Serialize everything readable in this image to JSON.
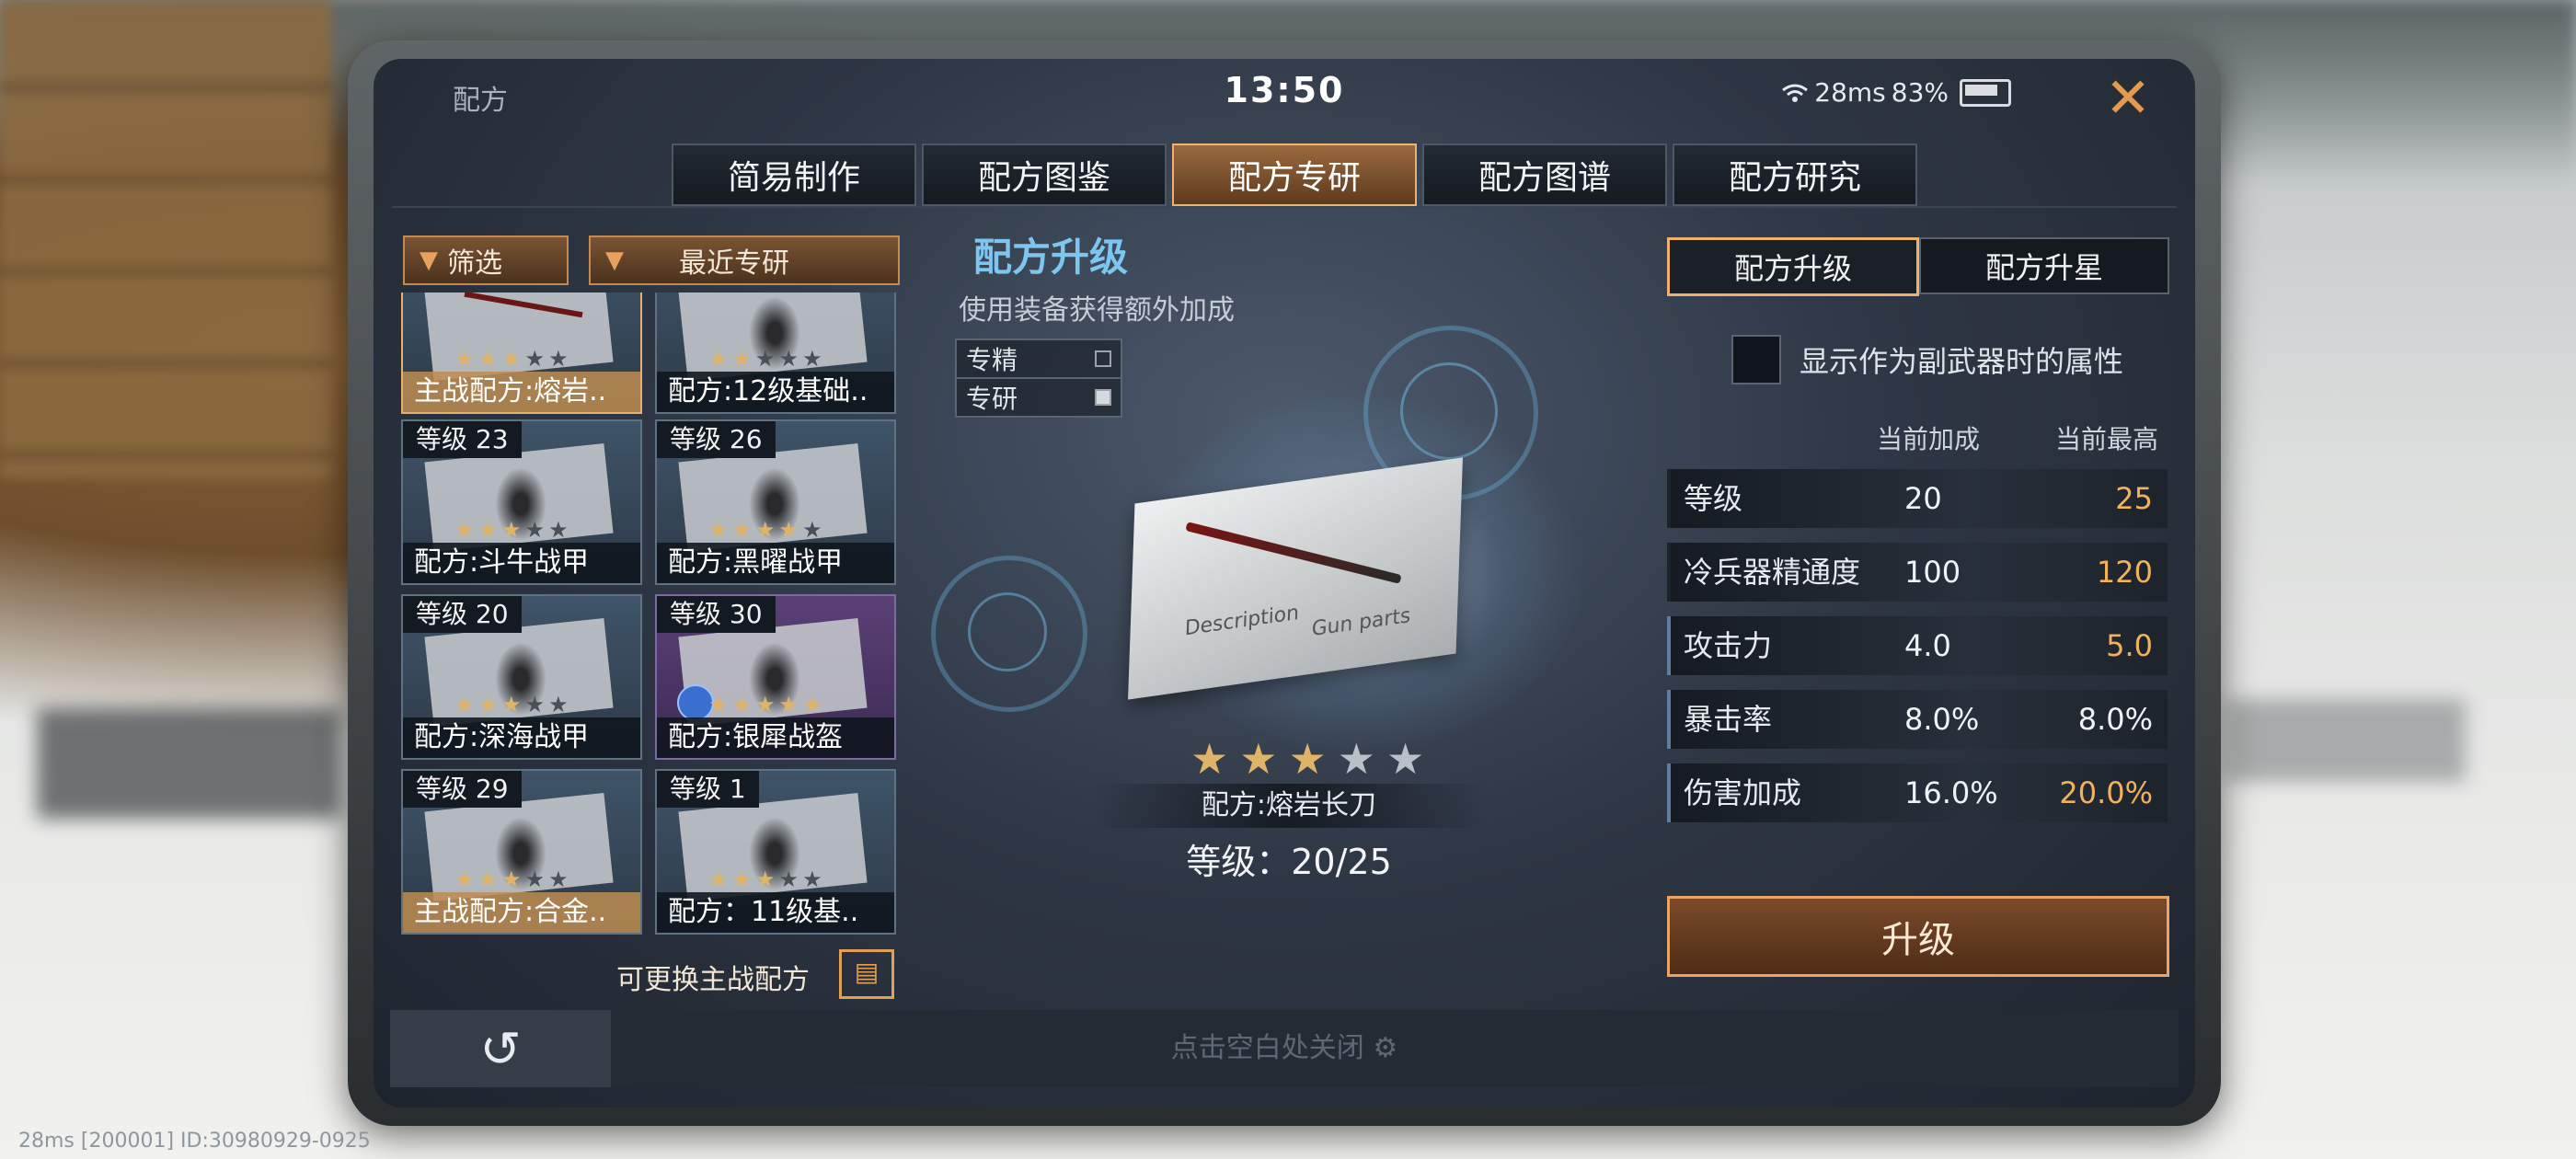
{
  "window": {
    "title": "配方",
    "time": "13:50",
    "ping": "28ms",
    "battery": "83%"
  },
  "tabs": [
    "简易制作",
    "配方图鉴",
    "配方专研",
    "配方图谱",
    "配方研究"
  ],
  "active_tab": 2,
  "filters": {
    "filter_label": "筛选",
    "recent_label": "最近专研"
  },
  "cards": [
    {
      "level": "",
      "name": "主战配方:熔岩..",
      "stars": 3,
      "selected": true
    },
    {
      "level": "",
      "name": "配方:12级基础..",
      "stars": 2,
      "selected": false
    },
    {
      "level": "等级 23",
      "name": "配方:斗牛战甲",
      "stars": 3,
      "selected": false
    },
    {
      "level": "等级 26",
      "name": "配方:黑曜战甲",
      "stars": 4,
      "selected": false
    },
    {
      "level": "等级 20",
      "name": "配方:深海战甲",
      "stars": 3,
      "selected": false
    },
    {
      "level": "等级 30",
      "name": "配方:银犀战盔",
      "stars": 5,
      "selected": false
    },
    {
      "level": "等级 29",
      "name": "主战配方:合金..",
      "stars": 3,
      "selected": false
    },
    {
      "level": "等级 1",
      "name": "配方：11级基..",
      "stars": 3,
      "selected": false
    }
  ],
  "replace_label": "可更换主战配方",
  "center": {
    "title": "配方升级",
    "subtitle": "使用装备获得额外加成",
    "legend": [
      "专精",
      "专研"
    ],
    "paper_text_1": "Description",
    "paper_text_2": "Gun parts",
    "stars": 3,
    "stars_total": 5,
    "item_name": "配方:熔岩长刀",
    "level_text": "等级：20/25"
  },
  "right": {
    "sub_tabs": [
      "配方升级",
      "配方升星"
    ],
    "checkbox_label": "显示作为副武器时的属性",
    "col_current": "当前加成",
    "col_max": "当前最高",
    "stats": [
      {
        "label": "等级",
        "current": "20",
        "max": "25",
        "up": true
      },
      {
        "label": "冷兵器精通度",
        "current": "100",
        "max": "120",
        "up": true
      },
      {
        "label": "攻击力",
        "current": "4.0",
        "max": "5.0",
        "up": true
      },
      {
        "label": "暴击率",
        "current": "8.0%",
        "max": "8.0%",
        "up": false
      },
      {
        "label": "伤害加成",
        "current": "16.0%",
        "max": "20.0%",
        "up": true
      }
    ],
    "upgrade_label": "升级"
  },
  "bottom": {
    "close_hint": "点击空白处关闭",
    "back_icon": "↺"
  },
  "debug": "28ms  [200001] ID:30980929-0925",
  "colors": {
    "accent": "#f0b070",
    "highlight": "#f3b15c",
    "title_blue": "#7cc6f0"
  }
}
